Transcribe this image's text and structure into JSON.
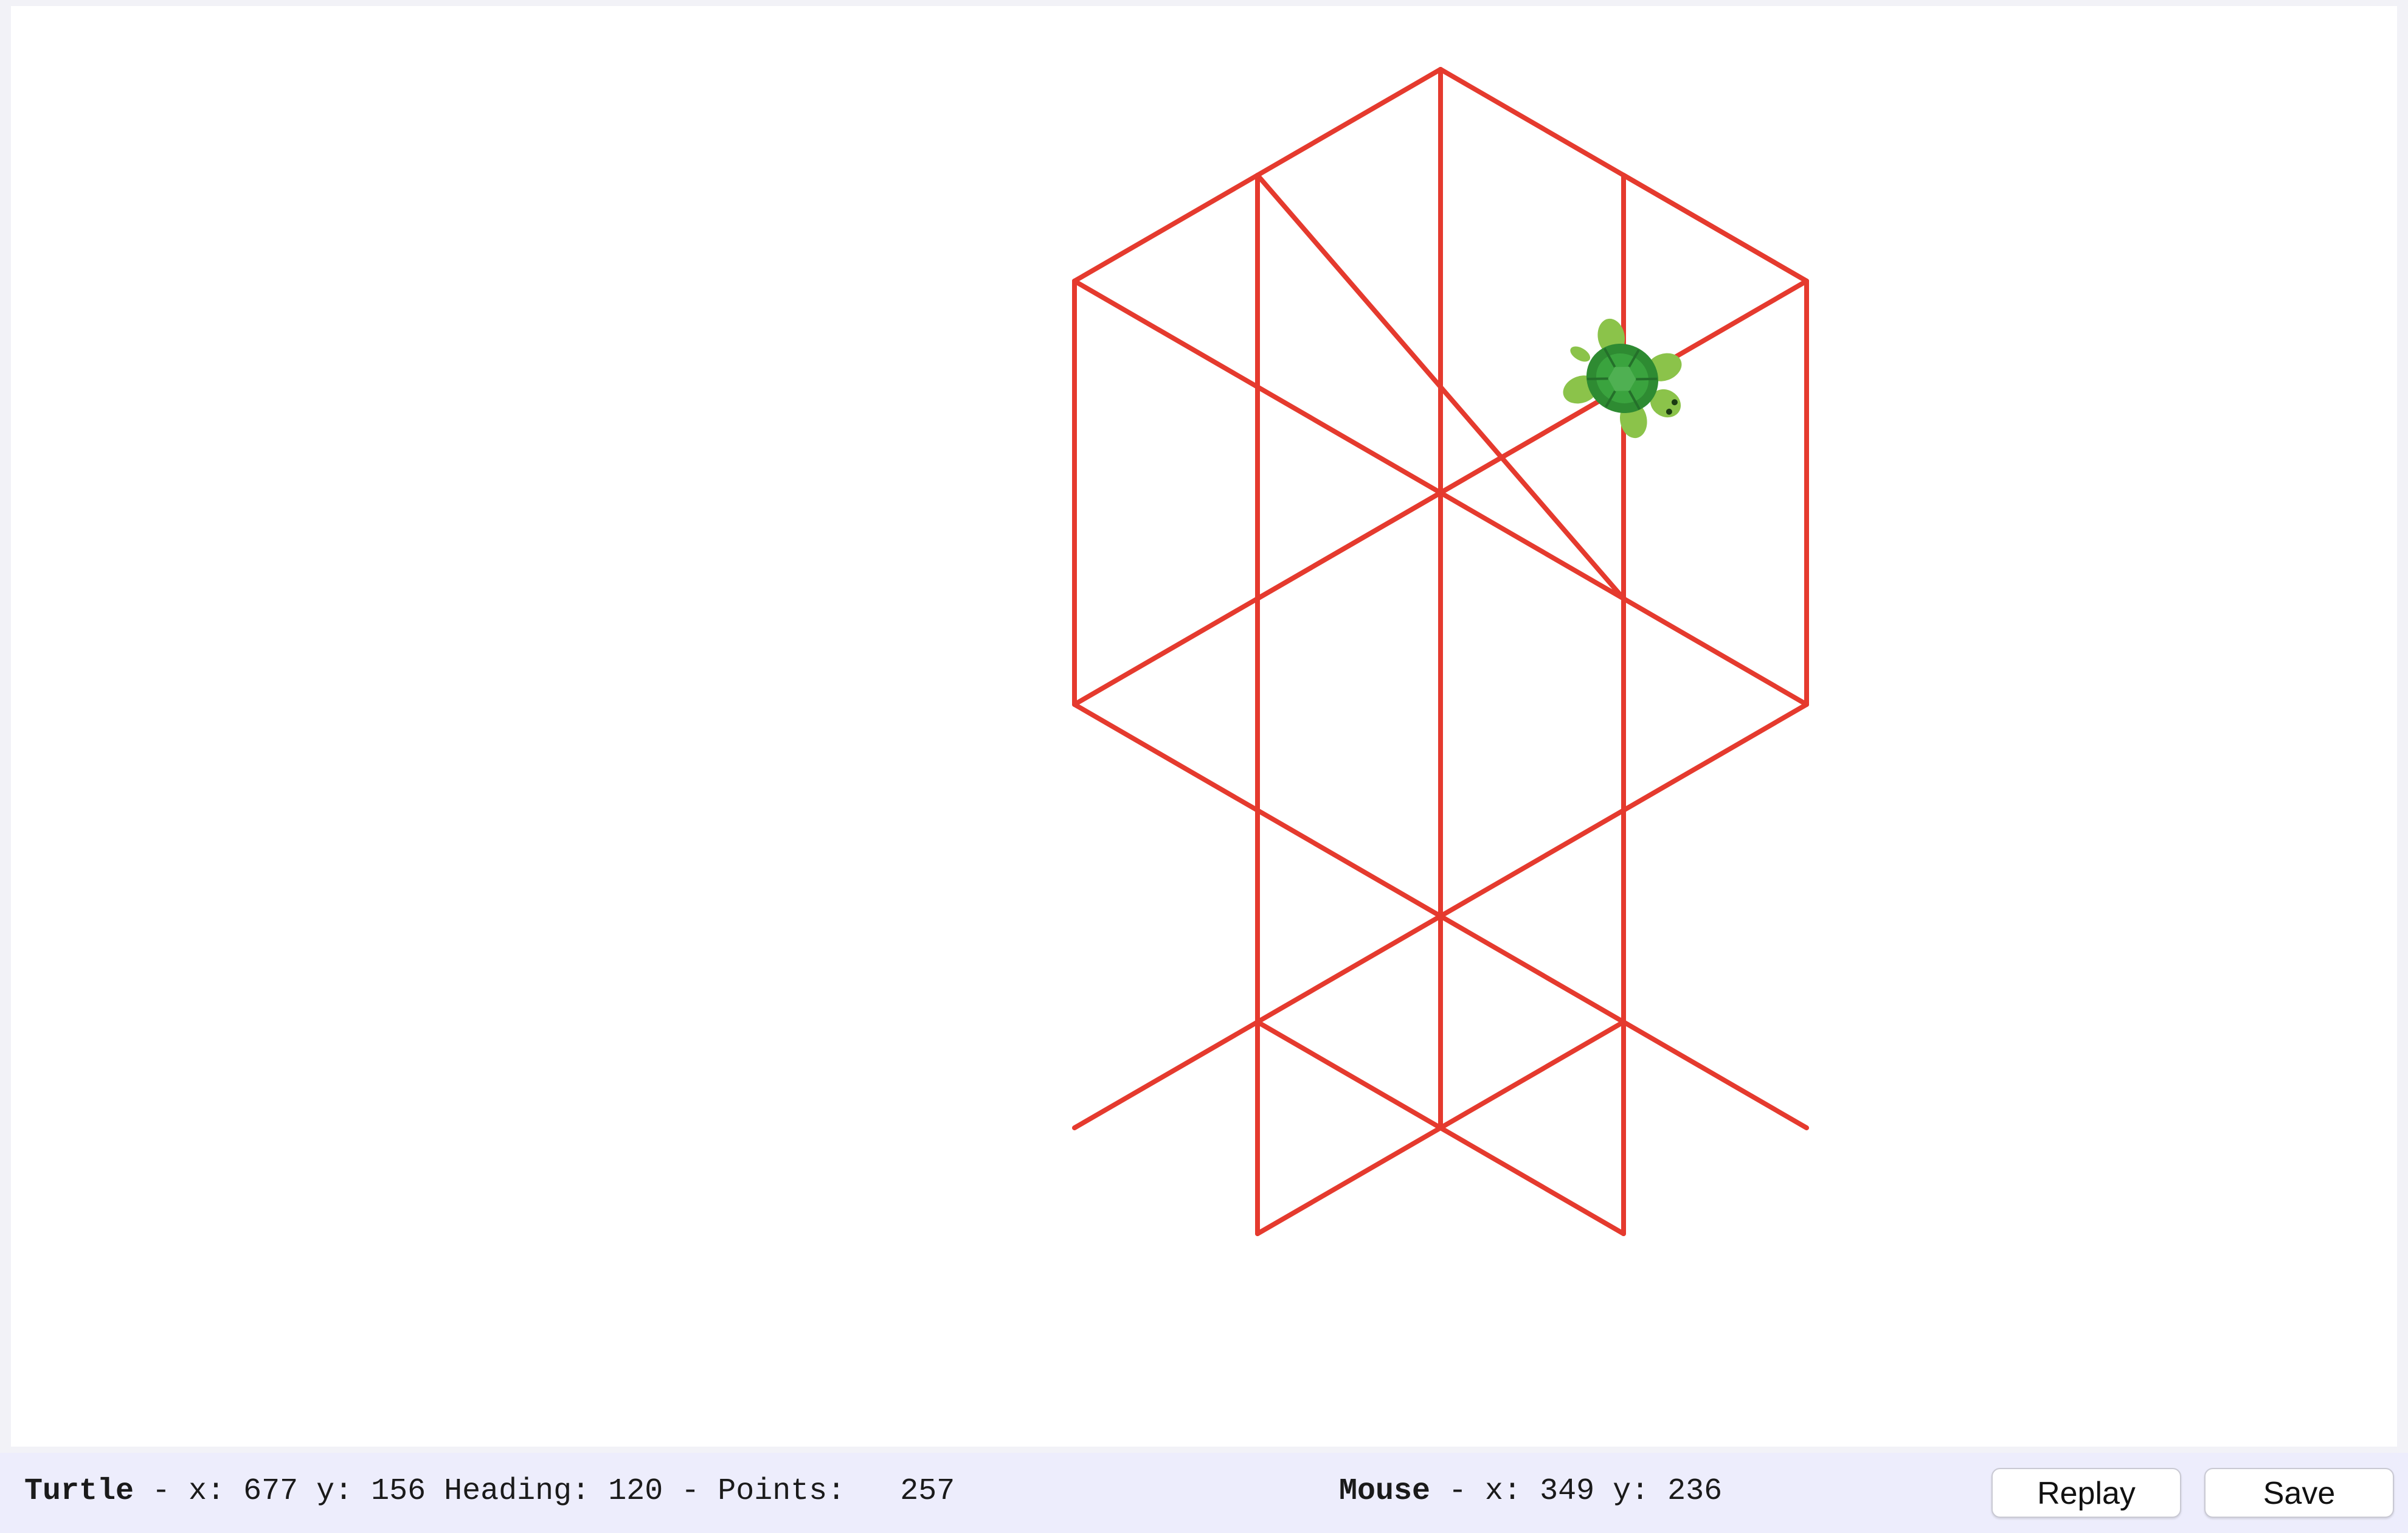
{
  "canvas": {
    "pen_color": "#e53a2e",
    "turtle_icon": "turtle-icon"
  },
  "status": {
    "turtle_label": "Turtle",
    "turtle_x_label": " - x: ",
    "turtle_x": "677",
    "turtle_y_label": " y: ",
    "turtle_y": "156",
    "heading_label": " Heading: ",
    "heading": "120",
    "points_label": " - Points:   ",
    "points": "257",
    "mouse_label": "Mouse",
    "mouse_x_label": " - x: ",
    "mouse_x": "349",
    "mouse_y_label": " y: ",
    "mouse_y": "236"
  },
  "buttons": {
    "replay_label": "Replay",
    "save_label": "Save"
  }
}
